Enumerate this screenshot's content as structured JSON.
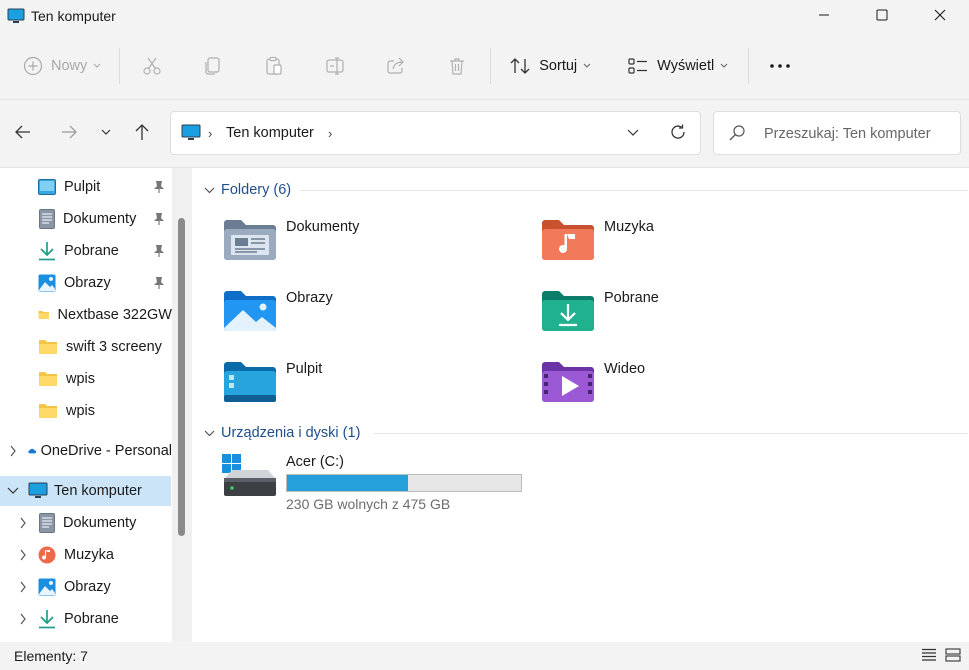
{
  "window": {
    "title": "Ten komputer",
    "icon": "monitor-icon",
    "controls": [
      "minimize-icon",
      "maximize-icon",
      "close-icon"
    ]
  },
  "commandbar": {
    "new_label": "Nowy",
    "sort_label": "Sortuj",
    "view_label": "Wyświetl",
    "disabled_actions": [
      "cut-icon",
      "copy-icon",
      "paste-icon",
      "rename-icon",
      "share-icon",
      "delete-icon"
    ],
    "more_icon": "more-icon"
  },
  "address": {
    "location": "Ten komputer",
    "search_placeholder": "Przeszukaj: Ten komputer"
  },
  "sidebar": {
    "quick_access": [
      {
        "label": "Pulpit",
        "icon": "desktop-icon",
        "pinned": true
      },
      {
        "label": "Dokumenty",
        "icon": "documents-icon",
        "pinned": true
      },
      {
        "label": "Pobrane",
        "icon": "download-icon",
        "pinned": true
      },
      {
        "label": "Obrazy",
        "icon": "pictures-icon",
        "pinned": true
      },
      {
        "label": "Nextbase 322GW",
        "icon": "folder-icon",
        "pinned": false
      },
      {
        "label": "swift 3 screeny",
        "icon": "folder-icon",
        "pinned": false
      },
      {
        "label": "wpis",
        "icon": "folder-icon",
        "pinned": false
      },
      {
        "label": "wpis",
        "icon": "folder-icon",
        "pinned": false
      }
    ],
    "onedrive": "OneDrive - Personal",
    "this_pc": "Ten komputer",
    "this_pc_children": [
      {
        "label": "Dokumenty",
        "icon": "documents-icon"
      },
      {
        "label": "Muzyka",
        "icon": "music-icon"
      },
      {
        "label": "Obrazy",
        "icon": "pictures-icon"
      },
      {
        "label": "Pobrane",
        "icon": "download-icon"
      }
    ]
  },
  "main": {
    "folders_header": "Foldery (6)",
    "folders": [
      {
        "name": "Dokumenty",
        "icon": "documents-folder-icon"
      },
      {
        "name": "Muzyka",
        "icon": "music-folder-icon"
      },
      {
        "name": "Obrazy",
        "icon": "pictures-folder-icon"
      },
      {
        "name": "Pobrane",
        "icon": "downloads-folder-icon"
      },
      {
        "name": "Pulpit",
        "icon": "desktop-folder-icon"
      },
      {
        "name": "Wideo",
        "icon": "video-folder-icon"
      }
    ],
    "devices_header": "Urządzenia i dyski (1)",
    "drive": {
      "name": "Acer (C:)",
      "free_text": "230 GB wolnych z 475 GB",
      "used_fraction": 0.516,
      "bar_color": "#26a0da"
    }
  },
  "status": {
    "items_text": "Elementy: 7"
  }
}
